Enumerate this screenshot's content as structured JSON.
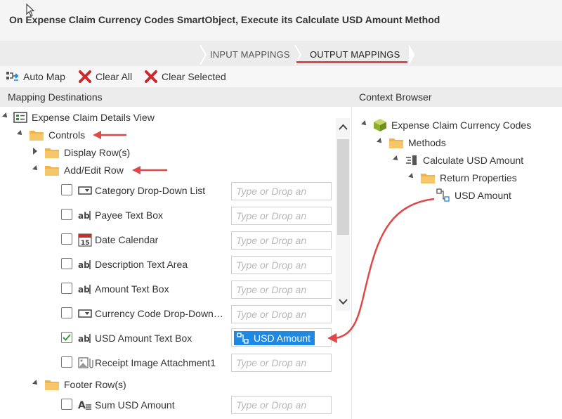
{
  "header": {
    "title": "On Expense Claim Currency Codes SmartObject, Execute its Calculate USD Amount Method"
  },
  "tabs": [
    {
      "label": "INPUT MAPPINGS",
      "active": false
    },
    {
      "label": "OUTPUT MAPPINGS",
      "active": true
    }
  ],
  "toolbar": {
    "auto_map": "Auto Map",
    "clear_all": "Clear All",
    "clear_selected": "Clear Selected"
  },
  "mapping_destinations": {
    "header": "Mapping Destinations",
    "root": "Expense Claim Details View",
    "controls": "Controls",
    "display_rows": "Display Row(s)",
    "add_edit_row": "Add/Edit Row",
    "footer_rows": "Footer Row(s)",
    "placeholder": "Type or Drop an",
    "fields": [
      {
        "label": "Category Drop-Down List",
        "checked": false,
        "value": ""
      },
      {
        "label": "Payee Text Box",
        "checked": false,
        "value": ""
      },
      {
        "label": "Date Calendar",
        "checked": false,
        "value": ""
      },
      {
        "label": "Description Text Area",
        "checked": false,
        "value": ""
      },
      {
        "label": "Amount Text Box",
        "checked": false,
        "value": ""
      },
      {
        "label": "Currency Code Drop-Down…",
        "checked": false,
        "value": ""
      },
      {
        "label": "USD Amount Text Box",
        "checked": true,
        "value": "USD Amount"
      },
      {
        "label": "Receipt Image Attachment1",
        "checked": false,
        "value": ""
      }
    ],
    "footer_fields": [
      {
        "label": "Sum USD Amount",
        "checked": false,
        "value": ""
      }
    ],
    "calendar_day": "15"
  },
  "context_browser": {
    "header": "Context Browser",
    "smartobject": "Expense Claim Currency Codes",
    "methods": "Methods",
    "method": "Calculate USD Amount",
    "return_properties": "Return Properties",
    "property": "USD Amount"
  },
  "colors": {
    "accent_red": "#e04848",
    "chip_blue": "#1e88e5",
    "folder": "#f0b44c"
  }
}
